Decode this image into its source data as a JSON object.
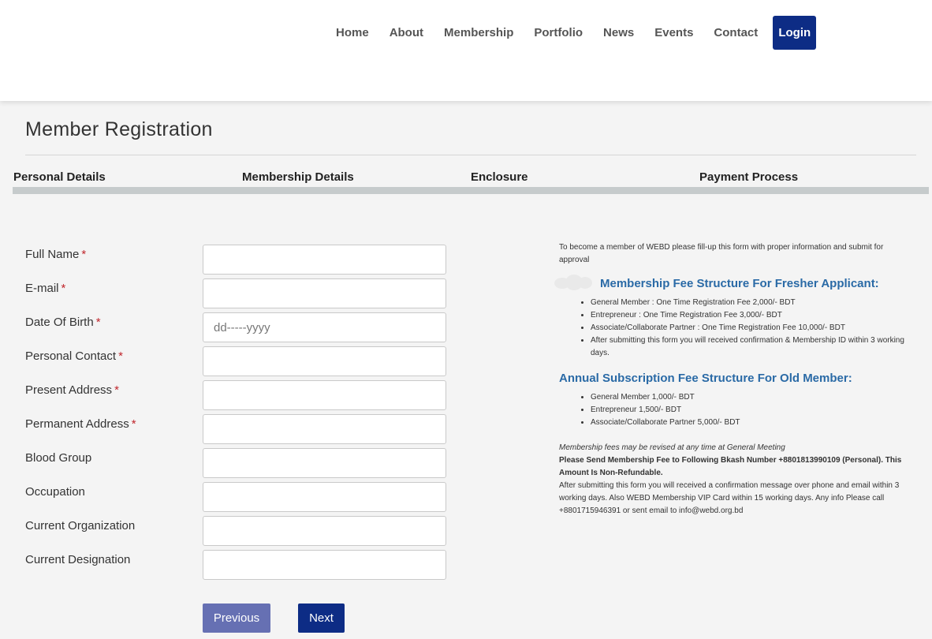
{
  "nav": {
    "items": [
      "Home",
      "About",
      "Membership",
      "Portfolio",
      "News",
      "Events",
      "Contact"
    ],
    "login_label": "Login"
  },
  "page": {
    "title": "Member Registration"
  },
  "steps": [
    "Personal Details",
    "Membership Details",
    "Enclosure",
    "Payment Process"
  ],
  "form": {
    "fields": [
      {
        "label": "Full Name",
        "required": true,
        "value": "",
        "placeholder": ""
      },
      {
        "label": "E-mail",
        "required": true,
        "value": "",
        "placeholder": ""
      },
      {
        "label": "Date Of Birth",
        "required": true,
        "value": "",
        "placeholder": "dd-----yyyy"
      },
      {
        "label": "Personal Contact",
        "required": true,
        "value": "",
        "placeholder": ""
      },
      {
        "label": "Present Address",
        "required": true,
        "value": "",
        "placeholder": ""
      },
      {
        "label": "Permanent Address",
        "required": true,
        "value": "",
        "placeholder": ""
      },
      {
        "label": "Blood Group",
        "required": false,
        "value": "",
        "placeholder": ""
      },
      {
        "label": "Occupation",
        "required": false,
        "value": "",
        "placeholder": ""
      },
      {
        "label": "Current Organization",
        "required": false,
        "value": "",
        "placeholder": ""
      },
      {
        "label": "Current Designation",
        "required": false,
        "value": "",
        "placeholder": ""
      }
    ],
    "required_mark": "*",
    "previous_label": "Previous",
    "next_label": "Next"
  },
  "info": {
    "intro": "To become a member of WEBD please fill-up this form with proper information and submit for approval",
    "fresher_heading": "Membership Fee Structure For Fresher Applicant:",
    "fresher_items": [
      "General Member : One Time Registration Fee 2,000/- BDT",
      "Entrepreneur : One Time Registration Fee 3,000/- BDT",
      "Associate/Collaborate Partner : One Time Registration Fee 10,000/- BDT",
      "After submitting this form you will received confirmation & Membership ID within 3 working days."
    ],
    "old_heading": "Annual Subscription Fee Structure For Old Member:",
    "old_items": [
      "General Member 1,000/- BDT",
      "Entrepreneur 1,500/- BDT",
      "Associate/Collaborate Partner 5,000/- BDT"
    ],
    "revision_note": "Membership fees may be revised at any time at General Meeting",
    "bkash_note": "Please Send Membership Fee to Following Bkash Number +8801813990109 (Personal). This Amount Is Non-Refundable.",
    "confirmation_note": "After submitting this form you will received a confirmation message over phone and email within 3 working days. Also WEBD Membership VIP Card within 15 working days. Any info Please call +8801715946391 or sent email to info@webd.org.bd"
  },
  "colors": {
    "primary": "#0d2c85",
    "previous_button": "#6670b3",
    "heading_blue": "#2a6aa6",
    "required_red": "#c0262c",
    "step_bar": "#c6cbcc"
  }
}
